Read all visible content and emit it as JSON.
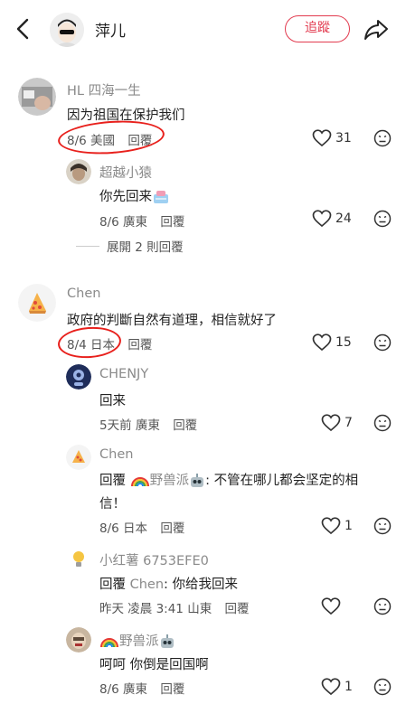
{
  "header": {
    "title": "萍儿",
    "follow_label": "追蹤"
  },
  "comments": [
    {
      "author": "HL 四海一生",
      "text": "因为祖国在保护我们",
      "date": "8/6",
      "location": "美國",
      "reply_label": "回覆",
      "likes": "31",
      "replies": [
        {
          "author": "超越小猿",
          "text": "你先回来",
          "date": "8/6",
          "location": "廣東",
          "reply_label": "回覆",
          "likes": "24"
        }
      ],
      "expand_label": "展開 2 則回覆"
    },
    {
      "author": "Chen",
      "text": "政府的判斷自然有道理，相信就好了",
      "date": "8/4",
      "location": "日本",
      "reply_label": "回覆",
      "likes": "15",
      "replies": [
        {
          "author": "CHENJY",
          "text": "回来",
          "date": "5天前",
          "location": "廣東",
          "reply_label": "回覆",
          "likes": "7"
        },
        {
          "author": "Chen",
          "text_prefix": "回覆",
          "mention": "野兽派",
          "text_line1": ": 不管在哪儿都会坚定的相",
          "text_line2": "信！",
          "date": "8/6",
          "location": "日本",
          "reply_label": "回覆",
          "likes": "1"
        },
        {
          "author": "小红薯 6753EFE0",
          "text_prefix": "回覆",
          "mention": "Chen",
          "text_rest": ": 你给我回来",
          "date": "昨天 凌晨 3:41",
          "location": "山東",
          "reply_label": "回覆",
          "likes": ""
        },
        {
          "author": "野兽派",
          "text": "呵呵 你倒是回国啊",
          "date": "8/6",
          "location": "廣東",
          "reply_label": "回覆",
          "likes": "1"
        }
      ]
    }
  ],
  "colors": {
    "accent": "#e23b4f",
    "annotation": "#e8201c",
    "secondary_text": "#8a8a8a"
  }
}
